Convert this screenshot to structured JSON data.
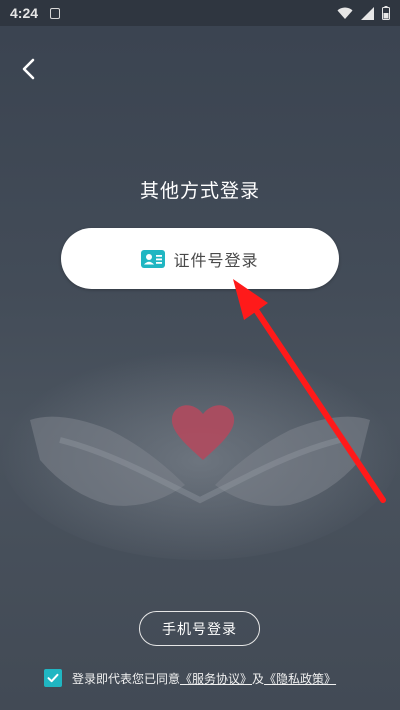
{
  "status_bar": {
    "time": "4:24"
  },
  "page": {
    "title": "其他方式登录"
  },
  "id_login": {
    "label": "证件号登录",
    "icon": "id-card-icon"
  },
  "phone_login": {
    "label": "手机号登录"
  },
  "agreement": {
    "prefix": "登录即代表您已同意",
    "service_link": "《服务协议》",
    "joiner": "及",
    "privacy_link": "《隐私政策》",
    "checked": true
  },
  "colors": {
    "accent": "#20b6c2",
    "background": "#434c58",
    "annotation_arrow": "#ff1a1a",
    "heart": "#b04a5e"
  }
}
